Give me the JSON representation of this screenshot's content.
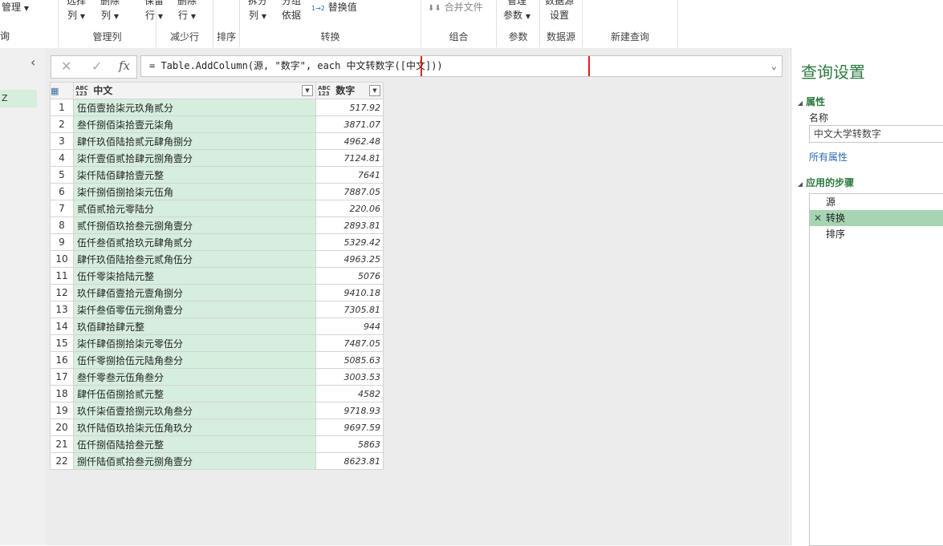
{
  "ribbon": {
    "manage_label": "管理",
    "query_label": "询",
    "choose_cols": [
      "选择",
      "列"
    ],
    "remove_cols": [
      "删除",
      "列"
    ],
    "group_manage_cols": "管理列",
    "keep_rows": [
      "保留",
      "行"
    ],
    "remove_rows": [
      "删除",
      "行"
    ],
    "group_reduce_rows": "减少行",
    "group_sort": "排序",
    "split_col": [
      "拆分",
      "列"
    ],
    "group_by": [
      "分组",
      "依据"
    ],
    "replace_values": "替换值",
    "replace_icon_text": "1→2",
    "group_transform": "转换",
    "merge_files": "合并文件",
    "group_combine": "组合",
    "manage_params": [
      "管理",
      "参数"
    ],
    "group_params": "参数",
    "datasource_settings": [
      "数据源",
      "设置"
    ],
    "group_datasource": "数据源",
    "group_new_query": "新建查询"
  },
  "left_pane": {
    "selected_item": "Z"
  },
  "formula_bar": {
    "cancel": "✕",
    "confirm": "✓",
    "fx": "fx",
    "formula": "= Table.AddColumn(源, \"数字\", each 中文转数字([中文]))"
  },
  "table": {
    "headers": [
      {
        "type_top": "ABC",
        "type_bottom": "123",
        "name": "中文"
      },
      {
        "type_top": "ABC",
        "type_bottom": "123",
        "name": "数字"
      }
    ],
    "rows": [
      {
        "n": "1",
        "cn": "伍佰壹拾柒元玖角贰分",
        "num": "517.92"
      },
      {
        "n": "2",
        "cn": "叁仟捌佰柒拾壹元柒角",
        "num": "3871.07"
      },
      {
        "n": "3",
        "cn": "肆仟玖佰陆拾贰元肆角捌分",
        "num": "4962.48"
      },
      {
        "n": "4",
        "cn": "柒仟壹佰贰拾肆元捌角壹分",
        "num": "7124.81"
      },
      {
        "n": "5",
        "cn": "柒仟陆佰肆拾壹元整",
        "num": "7641"
      },
      {
        "n": "6",
        "cn": "柒仟捌佰捌拾柒元伍角",
        "num": "7887.05"
      },
      {
        "n": "7",
        "cn": "贰佰贰拾元零陆分",
        "num": "220.06"
      },
      {
        "n": "8",
        "cn": "贰仟捌佰玖拾叁元捌角壹分",
        "num": "2893.81"
      },
      {
        "n": "9",
        "cn": "伍仟叁佰贰拾玖元肆角贰分",
        "num": "5329.42"
      },
      {
        "n": "10",
        "cn": "肆仟玖佰陆拾叁元贰角伍分",
        "num": "4963.25"
      },
      {
        "n": "11",
        "cn": "伍仟零柒拾陆元整",
        "num": "5076"
      },
      {
        "n": "12",
        "cn": "玖仟肆佰壹拾元壹角捌分",
        "num": "9410.18"
      },
      {
        "n": "13",
        "cn": "柒仟叁佰零伍元捌角壹分",
        "num": "7305.81"
      },
      {
        "n": "14",
        "cn": "玖佰肆拾肆元整",
        "num": "944"
      },
      {
        "n": "15",
        "cn": "柒仟肆佰捌拾柒元零伍分",
        "num": "7487.05"
      },
      {
        "n": "16",
        "cn": "伍仟零捌拾伍元陆角叁分",
        "num": "5085.63"
      },
      {
        "n": "17",
        "cn": "叁仟零叁元伍角叁分",
        "num": "3003.53"
      },
      {
        "n": "18",
        "cn": "肆仟伍佰捌拾贰元整",
        "num": "4582"
      },
      {
        "n": "19",
        "cn": "玖仟柒佰壹拾捌元玖角叁分",
        "num": "9718.93"
      },
      {
        "n": "20",
        "cn": "玖仟陆佰玖拾柒元伍角玖分",
        "num": "9697.59"
      },
      {
        "n": "21",
        "cn": "伍仟捌佰陆拾叁元整",
        "num": "5863"
      },
      {
        "n": "22",
        "cn": "捌仟陆佰贰拾叁元捌角壹分",
        "num": "8623.81"
      }
    ]
  },
  "query_settings": {
    "title": "查询设置",
    "properties_header": "属性",
    "name_label": "名称",
    "name_value": "中文大学转数字",
    "all_properties": "所有属性",
    "steps_header": "应用的步骤",
    "steps": [
      {
        "label": "源",
        "selected": false
      },
      {
        "label": "转换",
        "selected": true
      },
      {
        "label": "排序",
        "selected": false
      }
    ]
  },
  "colors": {
    "accent_green": "#2c7a3f",
    "selected_column": "#d6eedd",
    "selected_step": "#a6d5b3",
    "highlight_box": "#e02020"
  }
}
